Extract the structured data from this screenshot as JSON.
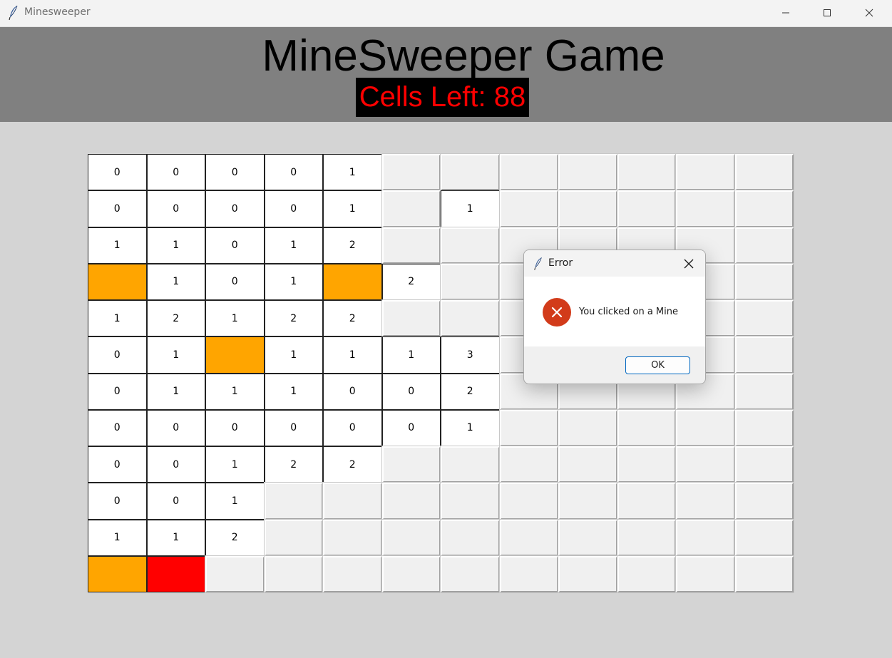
{
  "window": {
    "title": "Minesweeper",
    "icon": "feather-icon"
  },
  "header": {
    "title": "MineSweeper Game",
    "cells_left": "Cells Left: 88",
    "colors": {
      "header_bg": "#808080",
      "counter_bg": "#000000",
      "counter_text": "#ff0000"
    }
  },
  "board": {
    "rows": 12,
    "cols": 12,
    "legend": {
      "H": "hidden",
      "M": "mine (orange)",
      "X": "clicked mine (red)"
    },
    "cells": [
      [
        "0",
        "0",
        "0",
        "0",
        "1",
        "H",
        "H",
        "H",
        "H",
        "H",
        "H",
        "H"
      ],
      [
        "0",
        "0",
        "0",
        "0",
        "1",
        "H",
        "1",
        "H",
        "H",
        "H",
        "H",
        "H"
      ],
      [
        "1",
        "1",
        "0",
        "1",
        "2",
        "H",
        "H",
        "H",
        "H",
        "H",
        "H",
        "H"
      ],
      [
        "M",
        "1",
        "0",
        "1",
        "M",
        "2",
        "H",
        "H",
        "H",
        "H",
        "H",
        "H"
      ],
      [
        "1",
        "2",
        "1",
        "2",
        "2",
        "H",
        "H",
        "H",
        "H",
        "H",
        "H",
        "H"
      ],
      [
        "0",
        "1",
        "M",
        "1",
        "1",
        "1",
        "3",
        "H",
        "H",
        "H",
        "H",
        "H"
      ],
      [
        "0",
        "1",
        "1",
        "1",
        "0",
        "0",
        "2",
        "H",
        "H",
        "H",
        "H",
        "H"
      ],
      [
        "0",
        "0",
        "0",
        "0",
        "0",
        "0",
        "1",
        "H",
        "H",
        "H",
        "H",
        "H"
      ],
      [
        "0",
        "0",
        "1",
        "2",
        "2",
        "H",
        "H",
        "H",
        "H",
        "H",
        "H",
        "H"
      ],
      [
        "0",
        "0",
        "1",
        "H",
        "H",
        "H",
        "H",
        "H",
        "H",
        "H",
        "H",
        "H"
      ],
      [
        "1",
        "1",
        "2",
        "H",
        "H",
        "H",
        "H",
        "H",
        "H",
        "H",
        "H",
        "H"
      ],
      [
        "M",
        "X",
        "H",
        "H",
        "H",
        "H",
        "H",
        "H",
        "H",
        "H",
        "H",
        "H"
      ]
    ],
    "colors": {
      "mine": "#ffa500",
      "hit": "#ff0000",
      "revealed": "#ffffff",
      "hidden": "#f0f0f0"
    }
  },
  "dialog": {
    "title": "Error",
    "message": "You clicked on a Mine",
    "ok_label": "OK",
    "icon": "error-icon"
  }
}
